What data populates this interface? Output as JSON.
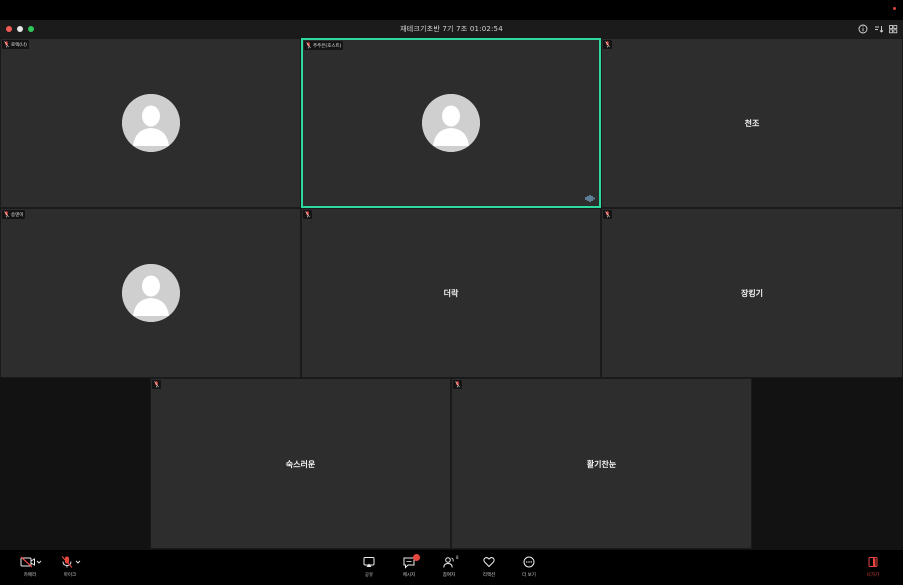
{
  "window": {
    "title": "재테크기초반 7기 7조 01:02:54"
  },
  "tiles": [
    {
      "name": "로렉(나)",
      "kind": "avatar",
      "active": false
    },
    {
      "name": "주주은(호스트)",
      "kind": "avatar",
      "active": true
    },
    {
      "name": "",
      "display": "천조",
      "kind": "text",
      "active": false
    },
    {
      "name": "승덴이",
      "kind": "avatar",
      "active": false
    },
    {
      "name": "",
      "display": "더락",
      "kind": "text",
      "active": false
    },
    {
      "name": "",
      "display": "장킹기",
      "kind": "text",
      "active": false
    },
    {
      "name": "",
      "display": "숙스러운",
      "kind": "text",
      "active": false
    },
    {
      "name": "",
      "display": "활기찬눈",
      "kind": "text",
      "active": false
    }
  ],
  "toolbar": {
    "camera_label": "카메라",
    "mic_label": "마이크",
    "share_label": "공유",
    "message_label": "메시지",
    "participants_label": "참여자",
    "participants_count": "8",
    "reaction_label": "리액션",
    "more_label": "더 보기",
    "leave_label": "나가기"
  },
  "colors": {
    "active_speaker_border": "#2ed9a0",
    "muted_mic": "#e8473f",
    "leave": "#e8473f",
    "tile_bg": "#2d2d2d"
  },
  "icons": {
    "camera": "camera-off-icon",
    "mic": "mic-off-icon",
    "share": "share-screen-icon",
    "message": "chat-icon",
    "participants": "participants-icon",
    "reaction": "heart-icon",
    "more": "more-icon",
    "leave": "leave-icon"
  }
}
